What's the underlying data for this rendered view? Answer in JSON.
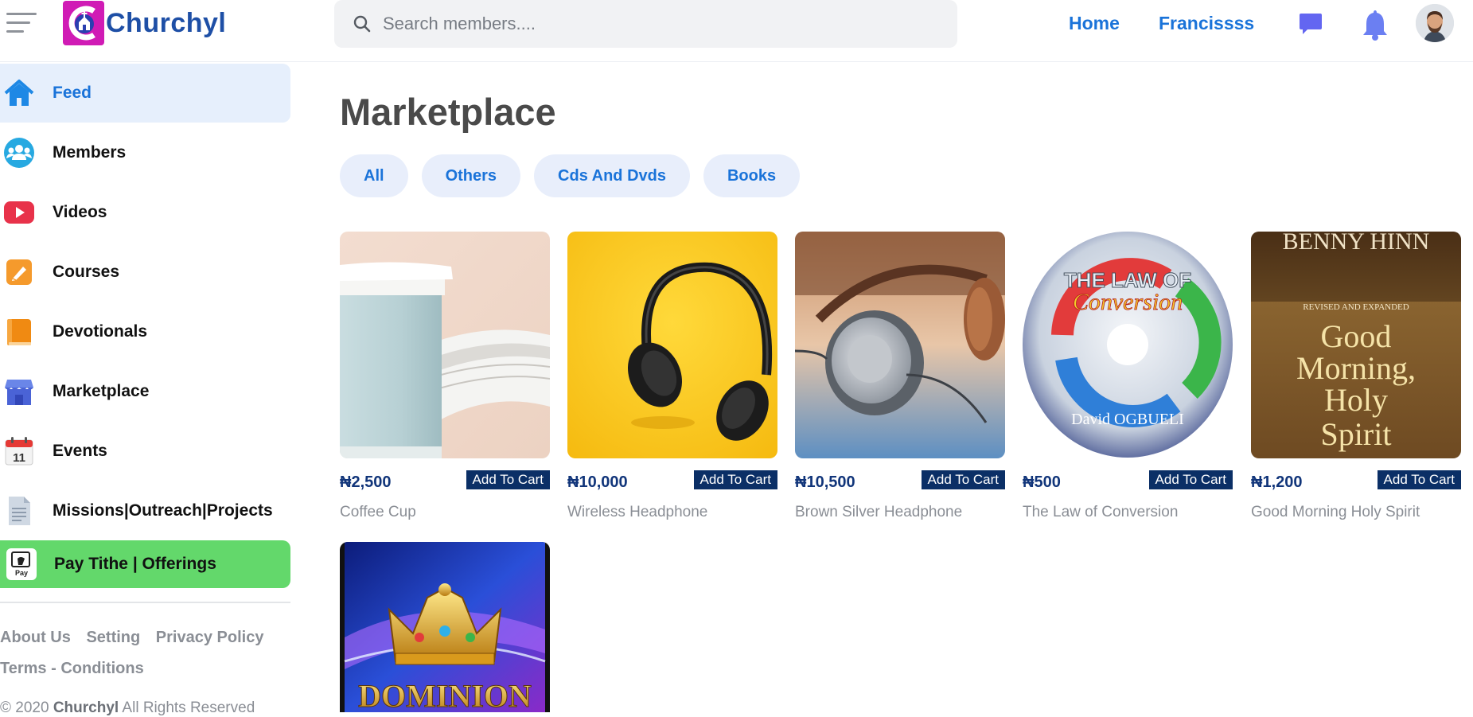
{
  "header": {
    "brand": "Churchyl",
    "search_placeholder": "Search members....",
    "nav": {
      "home": "Home",
      "user": "Francissss"
    }
  },
  "sidebar": {
    "items": [
      {
        "label": "Feed",
        "icon": "home-icon"
      },
      {
        "label": "Members",
        "icon": "members-icon"
      },
      {
        "label": "Videos",
        "icon": "video-icon"
      },
      {
        "label": "Courses",
        "icon": "courses-icon"
      },
      {
        "label": "Devotionals",
        "icon": "book-icon"
      },
      {
        "label": "Marketplace",
        "icon": "store-icon"
      },
      {
        "label": "Events",
        "icon": "calendar-icon"
      },
      {
        "label": "Missions|Outreach|Projects",
        "icon": "document-icon"
      }
    ],
    "calendar_day": "11",
    "pay": {
      "label": "Pay Tithe | Offerings",
      "icon_text": "Pay"
    },
    "footer_links": [
      "About Us",
      "Setting",
      "Privacy Policy",
      "Terms - Conditions"
    ],
    "copyright_prefix": "© 2020",
    "copyright_brand": "Churchyl",
    "copyright_suffix": "All Rights Reserved"
  },
  "main": {
    "title": "Marketplace",
    "filters": [
      "All",
      "Others",
      "Cds And Dvds",
      "Books"
    ],
    "add_to_cart": "Add To Cart",
    "products": [
      {
        "name": "Coffee Cup",
        "price": "₦2,500"
      },
      {
        "name": "Wireless Headphone",
        "price": "₦10,000"
      },
      {
        "name": "Brown Silver Headphone",
        "price": "₦10,500"
      },
      {
        "name": "The Law of Conversion",
        "price": "₦500"
      },
      {
        "name": "Good Morning Holy Spirit",
        "price": "₦1,200"
      },
      {
        "name": "",
        "price": ""
      }
    ],
    "artwork_text": {
      "law_title_1": "THE LAW OF",
      "law_title_2": "Conversion",
      "law_author": "David OGBUELI",
      "book_author": "BENNY HINN",
      "book_edition": "REVISED AND EXPANDED",
      "book_line_1": "Good",
      "book_line_2": "Morning,",
      "book_line_3": "Holy",
      "book_line_4": "Spirit",
      "dominion": "DOMINION"
    }
  },
  "colors": {
    "accent": "#1a73d9",
    "active_bg": "#e6effc",
    "pay_green": "#63d86b",
    "cart_button": "#0b2f66",
    "price": "#11357a",
    "brand_magenta": "#d01bb5"
  }
}
